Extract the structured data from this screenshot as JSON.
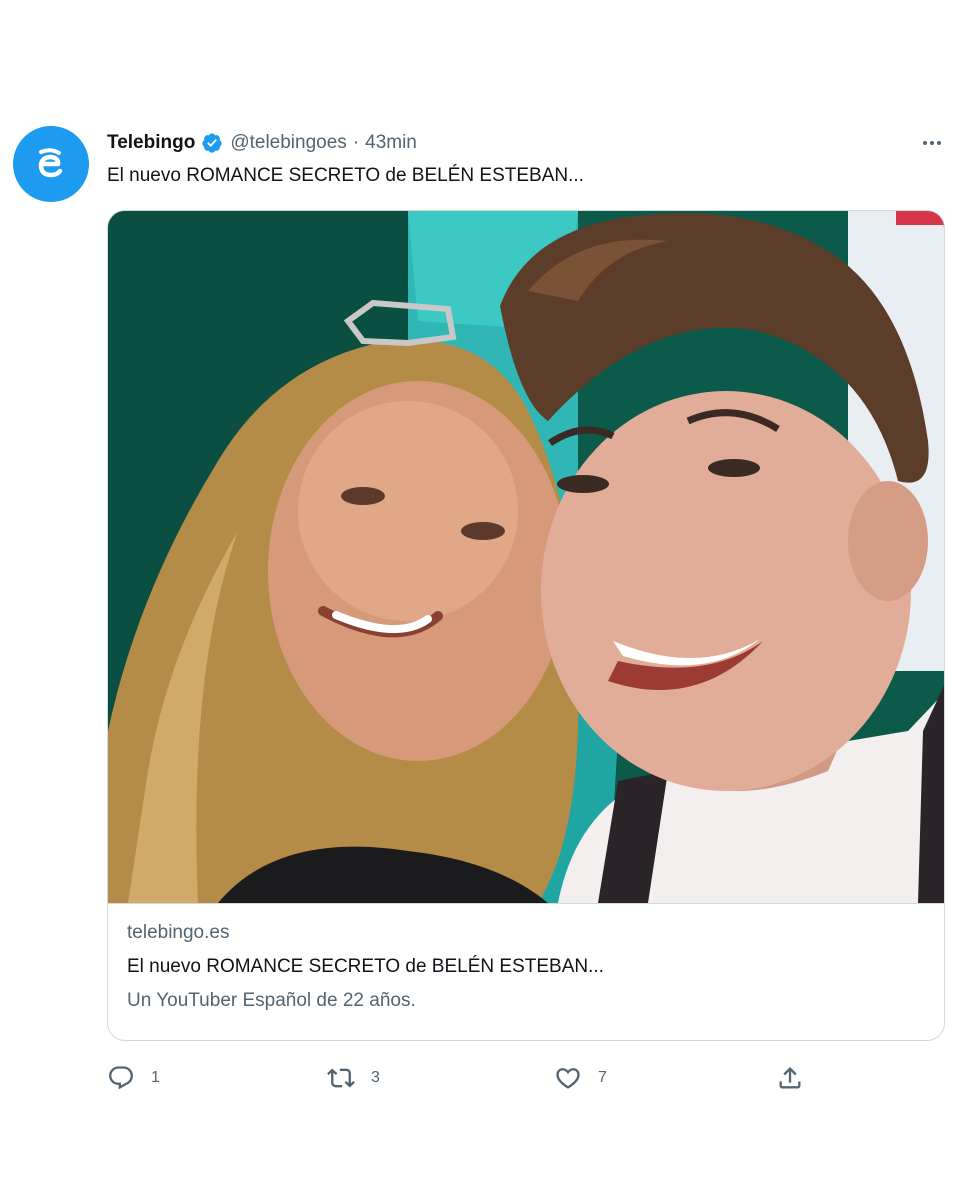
{
  "tweet": {
    "author": {
      "display_name": "Telebingo",
      "handle": "@telebingoes",
      "separator": "·",
      "time": "43min",
      "verified": true,
      "avatar_icon": "telebingo-logo-icon",
      "avatar_color": "#1d9bf0"
    },
    "text": "El nuevo ROMANCE SECRETO de BELÉN ESTEBAN...",
    "more_icon": "more-dots-icon",
    "card": {
      "image": "selfie-photo",
      "domain": "telebingo.es",
      "title": "El nuevo ROMANCE SECRETO de BELÉN ESTEBAN...",
      "description": "Un YouTuber Español de 22 años."
    },
    "actions": {
      "reply": {
        "icon": "reply-icon",
        "count": "1"
      },
      "retweet": {
        "icon": "retweet-icon",
        "count": "3"
      },
      "like": {
        "icon": "heart-icon",
        "count": "7"
      },
      "share": {
        "icon": "share-icon"
      }
    }
  },
  "colors": {
    "accent": "#1d9bf0",
    "text_primary": "#0f1419",
    "text_secondary": "#536471",
    "border": "#cfd9de"
  }
}
